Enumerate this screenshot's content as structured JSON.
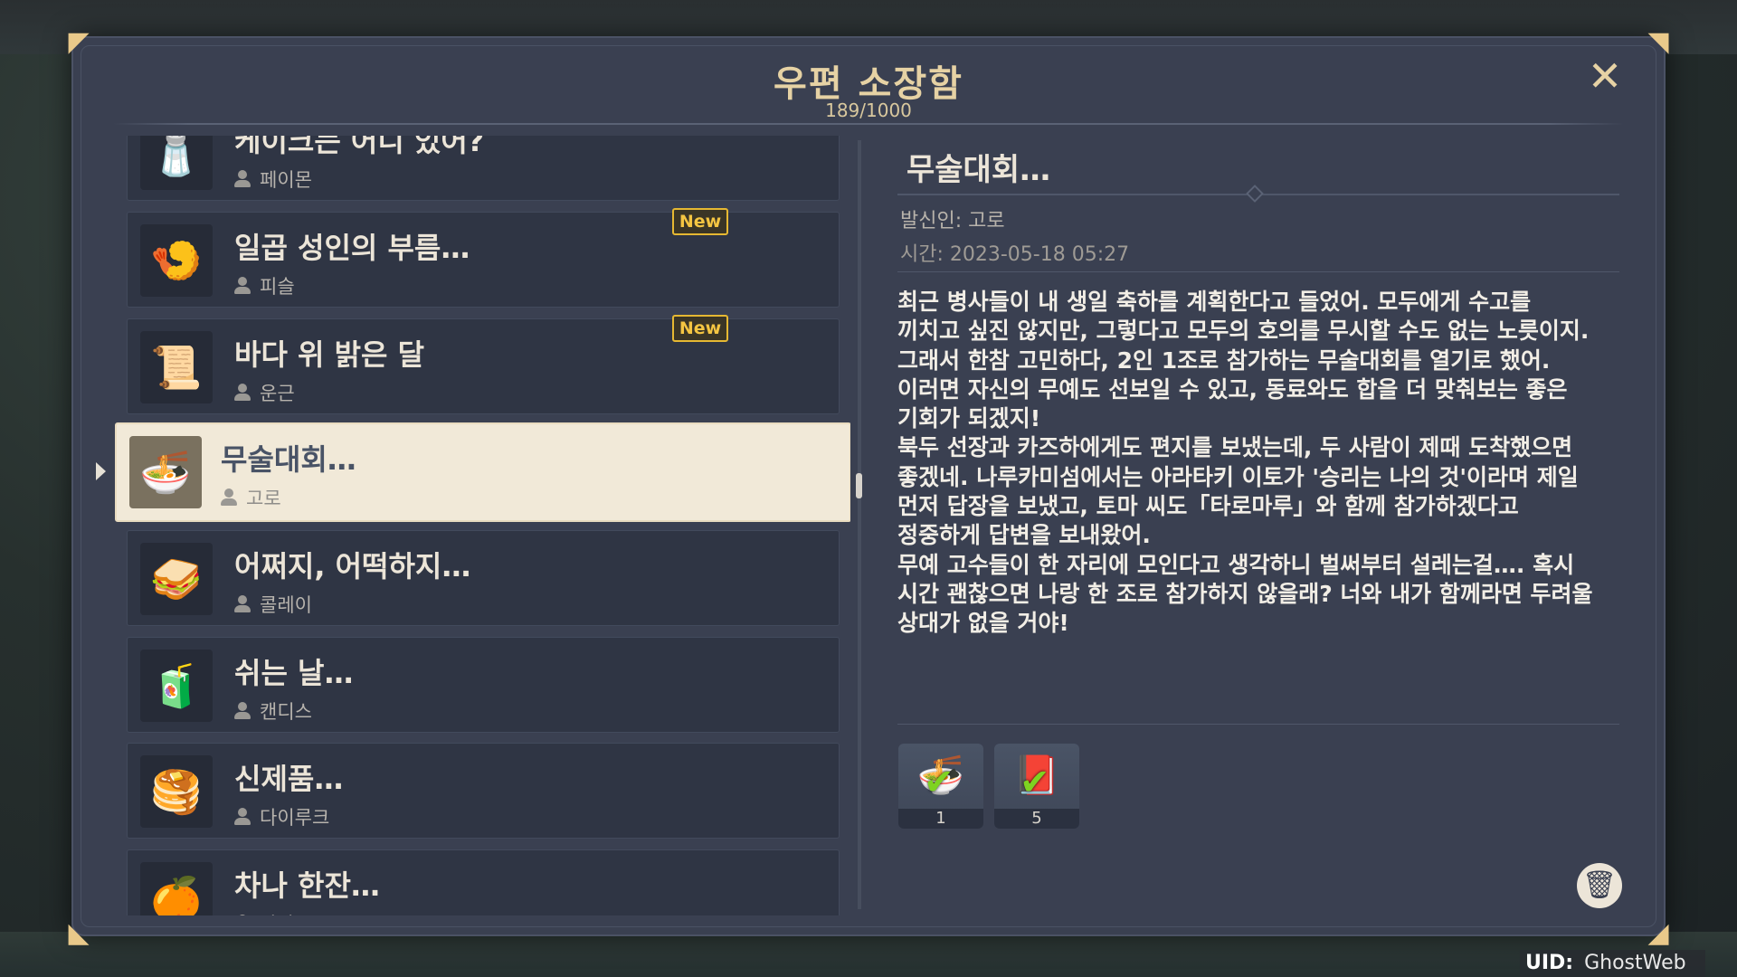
{
  "mailbox": {
    "title": "우편 소장함",
    "count": "189/1000",
    "close_icon": "close-icon"
  },
  "mails": [
    {
      "subject": "케이크는 어디 있어?",
      "sender": "페이몬",
      "icon": "🧂",
      "new": false
    },
    {
      "subject": "일곱 성인의 부름…",
      "sender": "피슬",
      "icon": "🍤",
      "new": true
    },
    {
      "subject": "바다 위 밝은 달",
      "sender": "운근",
      "icon": "📜",
      "new": true
    },
    {
      "subject": "무술대회…",
      "sender": "고로",
      "icon": "🍜",
      "new": false,
      "selected": true
    },
    {
      "subject": "어쩌지, 어떡하지…",
      "sender": "콜레이",
      "icon": "🥪",
      "new": false
    },
    {
      "subject": "쉬는 날…",
      "sender": "캔디스",
      "icon": "🧃",
      "new": false
    },
    {
      "subject": "신제품…",
      "sender": "다이루크",
      "icon": "🥞",
      "new": false
    },
    {
      "subject": "차나 한잔…",
      "sender": "아라",
      "icon": "🍊",
      "new": false
    }
  ],
  "new_label": "New",
  "detail": {
    "subject": "무술대회…",
    "from": "발신인: 고로",
    "time": "시간: 2023-05-18 05:27",
    "body": "최근 병사들이 내 생일 축하를 계획한다고 들었어. 모두에게 수고를\n끼치고 싶진 않지만, 그렇다고 모두의 호의를 무시할 수도 없는 노릇이지.\n그래서 한참 고민하다, 2인 1조로 참가하는 무술대회를 열기로 했어.\n이러면 자신의 무예도 선보일 수 있고, 동료와도 합을 더 맞춰보는 좋은\n기회가 되겠지!\n북두 선장과 카즈하에게도 편지를 보냈는데, 두 사람이 제때 도착했으면\n좋겠네. 나루카미섬에서는 아라타키 이토가 '승리는 나의 것'이라며 제일\n먼저 답장을 보냈고, 토마 씨도「타로마루」와 함께 참가하겠다고\n정중하게 답변을 보내왔어.\n무예 고수들이 한 자리에 모인다고 생각하니 벌써부터 설레는걸…. 혹시\n시간 괜찮으면 나랑 한 조로 참가하지 않을래? 너와 내가 함께라면 두려울\n상대가 없을 거야!",
    "attachments": [
      {
        "icon": "🍜",
        "qty": "1"
      },
      {
        "icon": "📕",
        "qty": "5"
      }
    ]
  },
  "uid": {
    "label": "UID:",
    "value": "GhostWeb"
  }
}
